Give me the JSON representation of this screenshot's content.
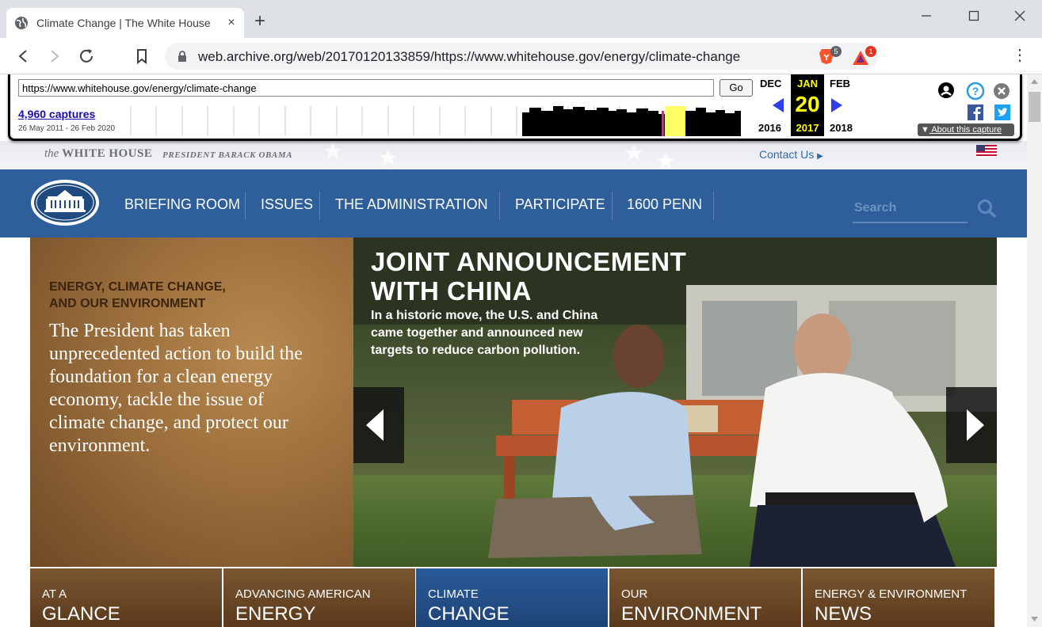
{
  "browser": {
    "tab_title": "Climate Change | The White House",
    "tab_close": "×",
    "new_tab": "+",
    "url": "web.archive.org/web/20170120133859/https://www.whitehouse.gov/energy/climate-change",
    "ext_brave_badge": "5",
    "ext_bat_badge": "1",
    "menu": "⋮"
  },
  "wayback": {
    "url_value": "https://www.whitehouse.gov/energy/climate-change",
    "go_label": "Go",
    "captures_link": "4,960 captures",
    "date_range": "26 May 2011 - 26 Feb 2020",
    "prev_month": "DEC",
    "prev_year": "2016",
    "cur_month": "JAN",
    "cur_day": "20",
    "cur_year": "2017",
    "next_month": "FEB",
    "next_year": "2018",
    "about_label": "About this capture"
  },
  "site": {
    "brand_the": "the",
    "brand_name": "WHITE HOUSE",
    "brand_president": "PRESIDENT BARACK OBAMA",
    "contact": "Contact Us",
    "nav": [
      "BRIEFING ROOM",
      "ISSUES",
      "THE ADMINISTRATION",
      "PARTICIPATE",
      "1600 PENN"
    ],
    "search_placeholder": "Search"
  },
  "hero": {
    "kicker_line1": "ENERGY, CLIMATE CHANGE,",
    "kicker_line2": "AND OUR ENVIRONMENT",
    "body": "The President has taken unprecedented action to build the foundation for a clean energy economy, tackle the issue of climate change, and protect our environment.",
    "slide_title_line1": "JOINT ANNOUNCEMENT",
    "slide_title_line2": "WITH CHINA",
    "slide_desc": "In a historic move, the U.S. and China came together and announced new targets to reduce carbon pollution."
  },
  "cards": [
    {
      "kicker": "AT A",
      "title": "GLANCE"
    },
    {
      "kicker": "ADVANCING AMERICAN",
      "title": "ENERGY"
    },
    {
      "kicker": "CLIMATE",
      "title": "CHANGE"
    },
    {
      "kicker": "OUR",
      "title": "ENVIRONMENT"
    },
    {
      "kicker": "ENERGY & ENVIRONMENT",
      "title": "NEWS"
    }
  ],
  "colors": {
    "nav_blue": "#2e5f9b",
    "active_card": "#2a5a99",
    "card_brown": "#7a5530",
    "wayback_yellow": "#ffff00",
    "link_blue": "#1a0dab"
  }
}
